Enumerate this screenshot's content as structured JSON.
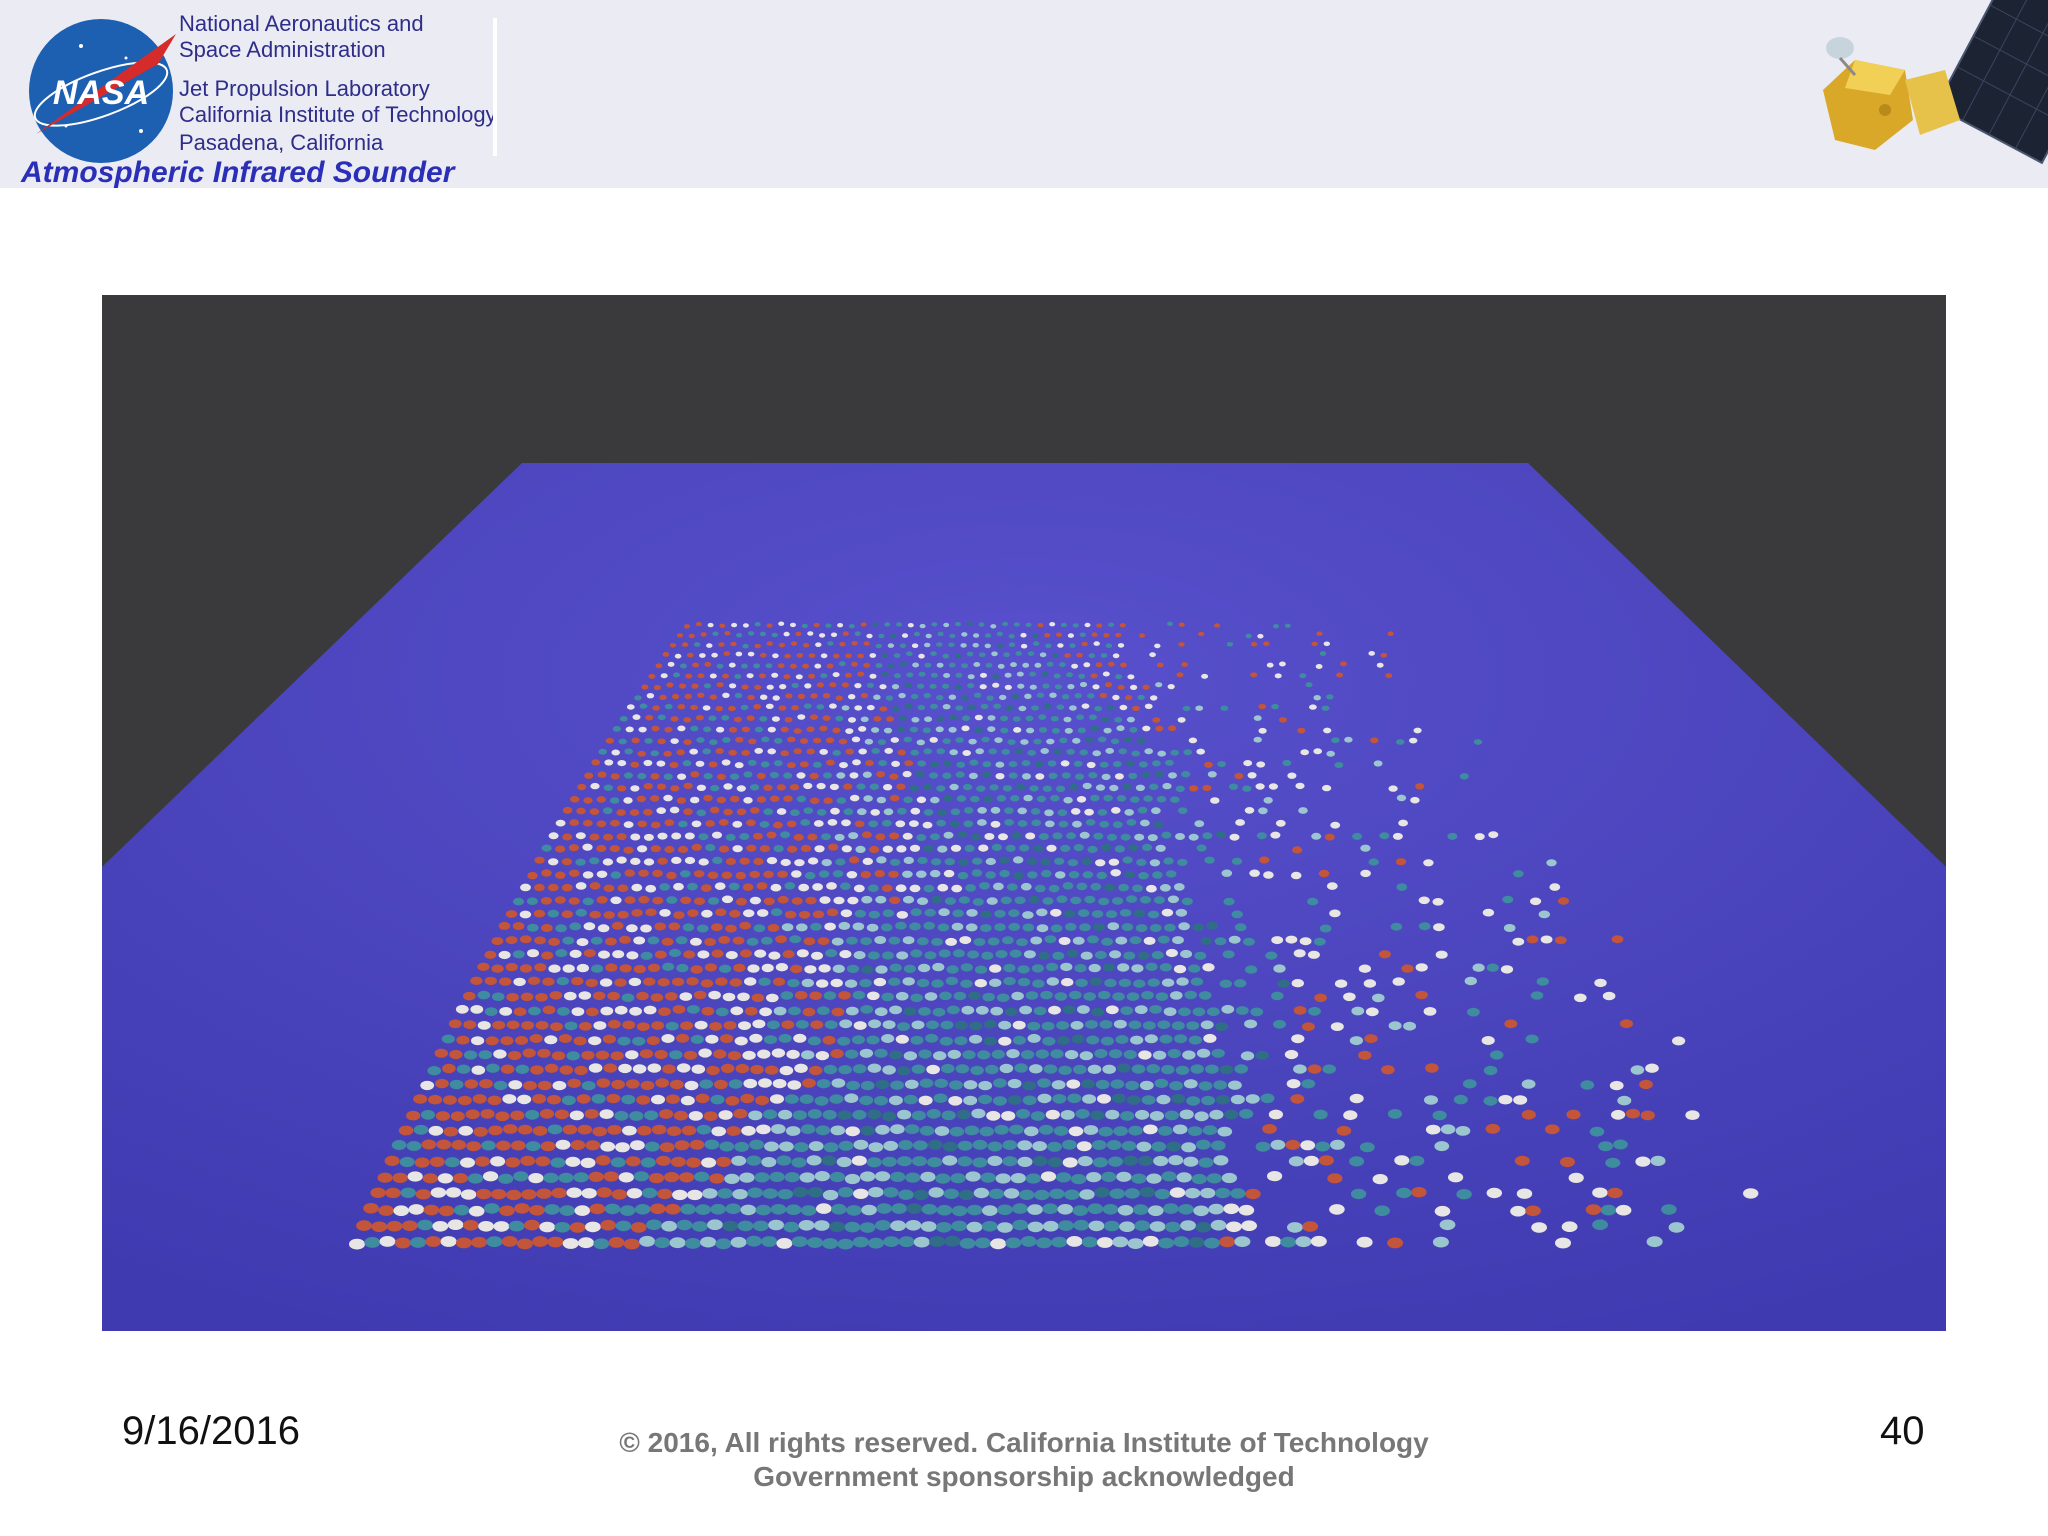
{
  "header": {
    "org_line1": "National Aeronautics and",
    "org_line2": "Space Administration",
    "lab_line1": "Jet Propulsion Laboratory",
    "lab_line2": "California Institute of Technology",
    "lab_line3": "Pasadena, California",
    "instrument": "Atmospheric Infrared Sounder",
    "logo_text": "NASA"
  },
  "colors": {
    "header_bg": "#ebebf3",
    "org_text": "#2e2e8a",
    "instrument_text": "#2b2fb8",
    "viz_background": "#3a3a3c",
    "viz_floor": "#4a45c0",
    "warm_marks": "#c2553a",
    "cool_marks": "#3f8ba0",
    "neutral_marks": "#e8e6e4"
  },
  "footer": {
    "date": "9/16/2016",
    "copyright_line1": "© 2016, All rights reserved. California Institute of Technology",
    "copyright_line2": "Government sponsorship acknowledged",
    "page_number": "40"
  }
}
